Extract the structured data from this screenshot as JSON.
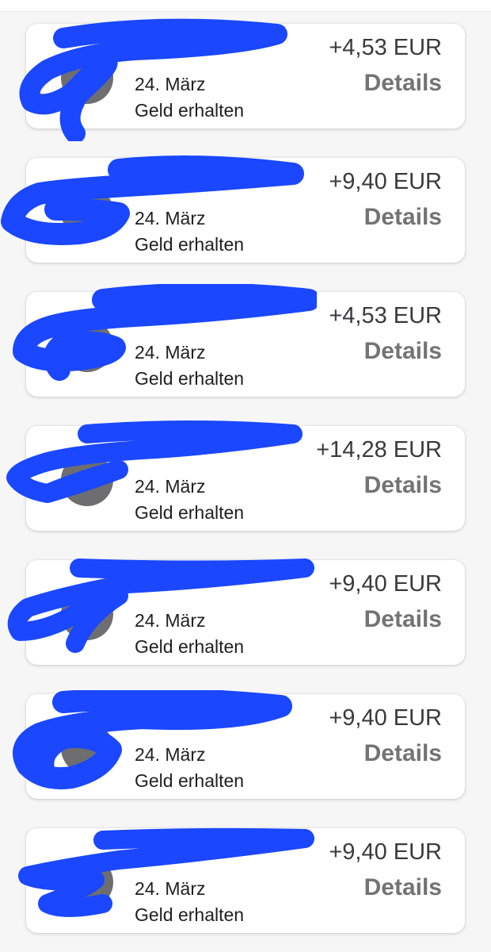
{
  "theme": {
    "card_background": "#ffffff",
    "page_background": "#f6f6f7",
    "avatar_color": "#6e6e70",
    "redaction_color": "#1a47ff",
    "details_color": "#737373"
  },
  "transactions": [
    {
      "name": "",
      "date": "24. März",
      "status": "Geld erhalten",
      "amount": "+4,53 EUR",
      "action": "Details"
    },
    {
      "name": "",
      "date": "24. März",
      "status": "Geld erhalten",
      "amount": "+9,40 EUR",
      "action": "Details"
    },
    {
      "name": "",
      "date": "24. März",
      "status": "Geld erhalten",
      "amount": "+4,53 EUR",
      "action": "Details"
    },
    {
      "name": "",
      "date": "24. März",
      "status": "Geld erhalten",
      "amount": "+14,28 EUR",
      "action": "Details"
    },
    {
      "name": "",
      "date": "24. März",
      "status": "Geld erhalten",
      "amount": "+9,40 EUR",
      "action": "Details"
    },
    {
      "name": "",
      "date": "24. März",
      "status": "Geld erhalten",
      "amount": "+9,40 EUR",
      "action": "Details"
    },
    {
      "name": "",
      "date": "24. März",
      "status": "Geld erhalten",
      "amount": "+9,40 EUR",
      "action": "Details"
    }
  ]
}
